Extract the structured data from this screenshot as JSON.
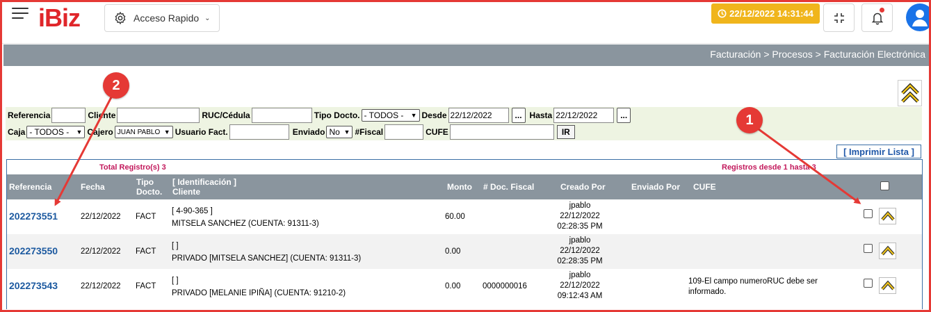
{
  "header": {
    "logo": "iBiz",
    "quick_access": "Acceso Rapido",
    "datetime": "22/12/2022 14:31:44"
  },
  "breadcrumb": "Facturación > Procesos > Facturación Electrónica",
  "filters": {
    "referencia_label": "Referencia",
    "cliente_label": "Cliente",
    "ruc_label": "RUC/Cédula",
    "tipo_label": "Tipo Docto.",
    "tipo_value": "- TODOS -",
    "desde_label": "Desde",
    "desde_value": "22/12/2022",
    "hasta_label": "Hasta",
    "hasta_value": "22/12/2022",
    "dots": "...",
    "caja_label": "Caja",
    "caja_value": "- TODOS -",
    "cajero_label": "Cajero",
    "cajero_value": "JUAN PABLO",
    "usuario_label": "Usuario Fact.",
    "enviado_label": "Enviado",
    "enviado_value": "No",
    "fiscal_label": "#Fiscal",
    "cufe_label": "CUFE",
    "ir_label": "IR"
  },
  "print_link": "[ Imprimir Lista ]",
  "summary": {
    "total": "Total Registro(s) 3",
    "range": "Registros desde 1 hasta 3"
  },
  "columns": {
    "referencia": "Referencia",
    "fecha": "Fecha",
    "tipo_l1": "Tipo",
    "tipo_l2": "Docto.",
    "ident_l1": "[ Identificación ]",
    "ident_l2": "Cliente",
    "monto": "Monto",
    "doc_fiscal": "# Doc. Fiscal",
    "creado": "Creado Por",
    "enviado": "Enviado Por",
    "cufe": "CUFE"
  },
  "rows": [
    {
      "ref": "202273551",
      "fecha": "22/12/2022",
      "tipo": "FACT",
      "ident": "[ 4-90-365 ]",
      "cliente": "MITSELA SANCHEZ (CUENTA: 91311-3)",
      "monto": "60.00",
      "fiscal": "",
      "user": "jpablo",
      "date": "22/12/2022",
      "time": "02:28:35 PM",
      "cufe_l1": "",
      "cufe_l2": ""
    },
    {
      "ref": "202273550",
      "fecha": "22/12/2022",
      "tipo": "FACT",
      "ident": "[ ]",
      "cliente": "PRIVADO [MITSELA SANCHEZ] (CUENTA: 91311-3)",
      "monto": "0.00",
      "fiscal": "",
      "user": "jpablo",
      "date": "22/12/2022",
      "time": "02:28:35 PM",
      "cufe_l1": "",
      "cufe_l2": ""
    },
    {
      "ref": "202273543",
      "fecha": "22/12/2022",
      "tipo": "FACT",
      "ident": "[ ]",
      "cliente": "PRIVADO [MELANIE IPIÑA] (CUENTA: 91210-2)",
      "monto": "0.00",
      "fiscal": "0000000016",
      "user": "jpablo",
      "date": "22/12/2022",
      "time": "09:12:43 AM",
      "cufe_l1": "109-El campo numeroRUC debe ser",
      "cufe_l2": "informado."
    }
  ],
  "annotations": {
    "one": "1",
    "two": "2"
  },
  "colors": {
    "accent": "#e53935",
    "badge": "#f0b51c",
    "header": "#8a959e",
    "link": "#1d5aa0"
  }
}
